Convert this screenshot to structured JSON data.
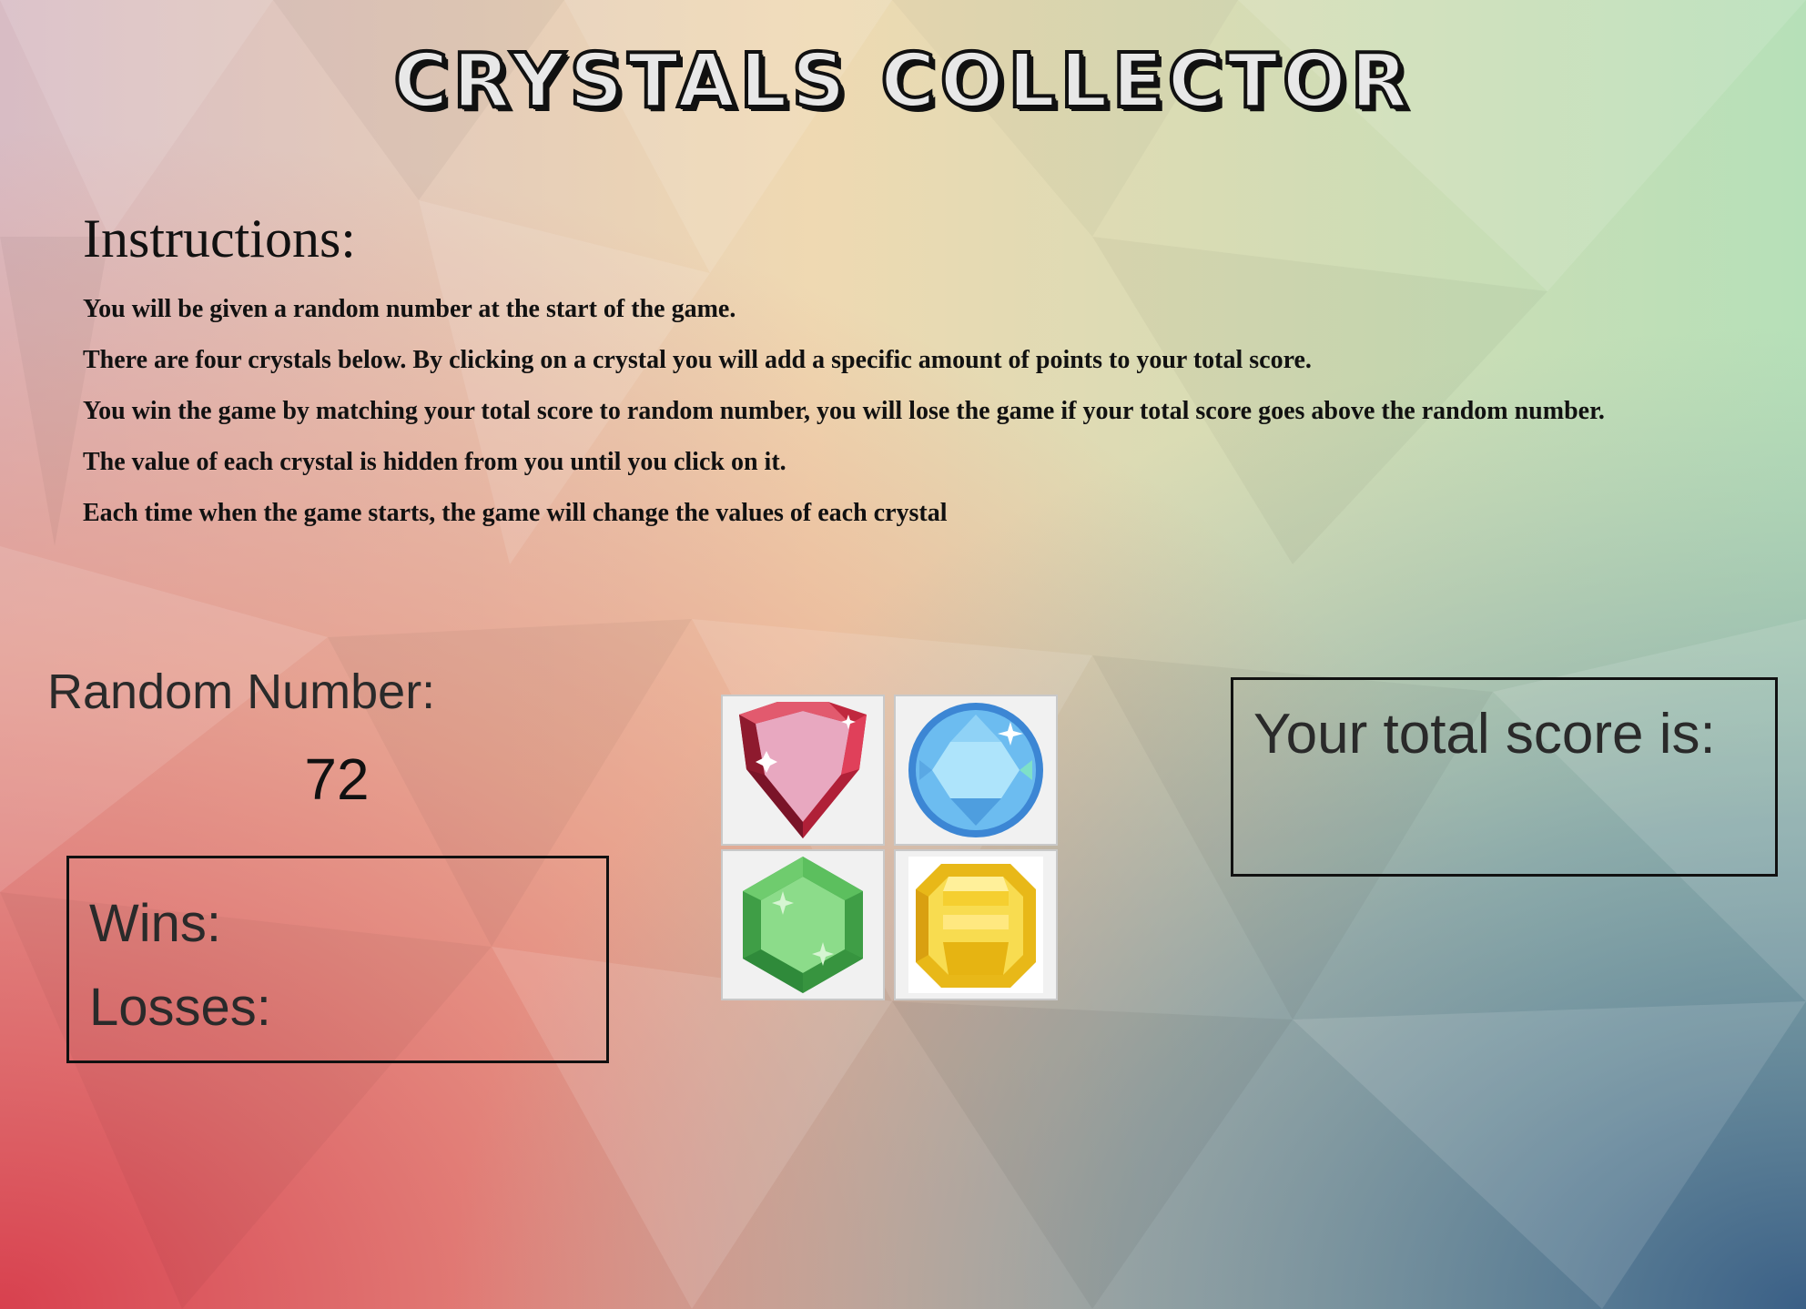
{
  "title": "Crystals Collector",
  "instructions": {
    "heading": "Instructions:",
    "lines": [
      "You will be given a random number at the start of the game.",
      "There are four crystals below. By clicking on a crystal you will add a specific amount of points to your total score.",
      "You win the game by matching your total score to random number, you will lose the game if your total score goes above the random number.",
      "The value of each crystal is hidden from you until you click on it.",
      "Each time when the game starts, the game will change the values of each crystal"
    ]
  },
  "random_number": {
    "label": "Random Number:",
    "value": "72"
  },
  "record": {
    "wins_label": "Wins:",
    "losses_label": "Losses:"
  },
  "score": {
    "label": "Your total score is:"
  },
  "crystals": [
    {
      "name": "red-crystal-icon",
      "color": "#d9324a"
    },
    {
      "name": "blue-crystal-icon",
      "color": "#4aa8e6"
    },
    {
      "name": "green-crystal-icon",
      "color": "#4caf50"
    },
    {
      "name": "yellow-crystal-icon",
      "color": "#f2c81f"
    }
  ],
  "background_colors": {
    "top_left": "#d9b8c0",
    "top_right": "#b8e0b4",
    "bottom_left": "#d84a52",
    "bottom_right": "#3f6f8a"
  }
}
